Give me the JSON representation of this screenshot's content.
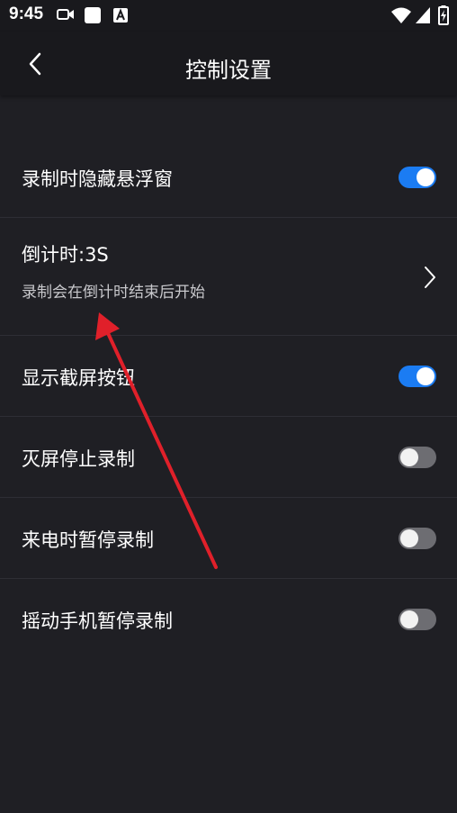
{
  "status_bar": {
    "time": "9:45",
    "icons": [
      "video-camera-icon",
      "square-notification-icon",
      "font-a-icon",
      "wifi-icon",
      "cellular-signal-icon",
      "battery-charging-icon"
    ]
  },
  "header": {
    "title": "控制设置",
    "back_icon": "chevron-left-icon"
  },
  "settings": [
    {
      "label": "录制时隐藏悬浮窗",
      "type": "toggle",
      "enabled": true
    },
    {
      "label": "倒计时:3S",
      "sublabel": "录制会在倒计时结束后开始",
      "type": "link"
    },
    {
      "label": "显示截屏按钮",
      "type": "toggle",
      "enabled": true
    },
    {
      "label": "灭屏停止录制",
      "type": "toggle",
      "enabled": false
    },
    {
      "label": "来电时暂停录制",
      "type": "toggle",
      "enabled": false
    },
    {
      "label": "摇动手机暂停录制",
      "type": "toggle",
      "enabled": false
    }
  ],
  "colors": {
    "background": "#1f1f24",
    "header_bg": "#19191d",
    "toggle_on": "#1b7cf3",
    "toggle_off": "#6d6d72",
    "annotation_arrow": "#e0202a"
  }
}
